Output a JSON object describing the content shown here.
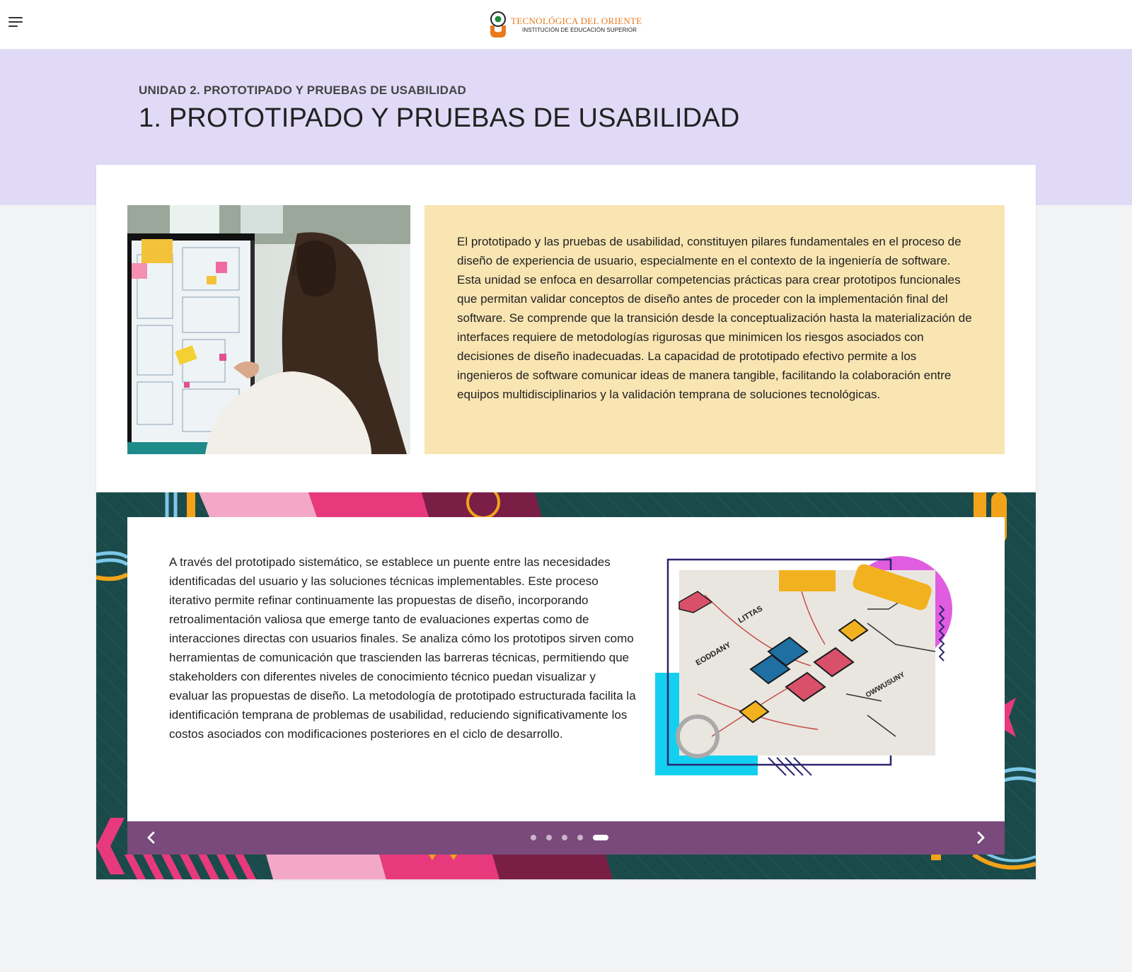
{
  "header": {
    "menu_icon": "hamburger-menu-icon",
    "logo": {
      "name": "TECNOLÓGICA DEL ORIENTE",
      "subtitle": "INSTITUCIÓN DE EDUCACIÓN SUPERIOR",
      "colors": {
        "orange": "#e9791e",
        "green": "#1e8a3c"
      }
    }
  },
  "hero": {
    "unit_label": "UNIDAD 2. PROTOTIPADO Y PRUEBAS DE USABILIDAD",
    "title": "1. PROTOTIPADO Y PRUEBAS DE USABILIDAD",
    "band_color": "#e0daf7"
  },
  "intro": {
    "image": "woman-at-monitor-with-sticky-notes",
    "text": "El prototipado y las pruebas de usabilidad, constituyen pilares fundamentales en el proceso de diseño de experiencia de usuario, especialmente en el contexto de la ingeniería de software. Esta unidad se enfoca en desarrollar competencias prácticas para crear prototipos funcionales que permitan validar conceptos de diseño antes de proceder con la implementación final del software. Se comprende que la transición desde la conceptualización hasta la materialización de interfaces requiere de metodologías rigurosas que minimicen los riesgos asociados con decisiones de diseño inadecuadas. La capacidad de prototipado efectivo permite a los ingenieros de software comunicar ideas de manera tangible, facilitando la colaboración entre equipos multidisciplinarios y la validación temprana de soluciones tecnológicas.",
    "box_color": "#f9e5b2"
  },
  "slider": {
    "text": "A través del prototipado sistemático, se establece un puente entre las necesidades identificadas del usuario y las soluciones técnicas implementables. Este proceso iterativo permite refinar continuamente las propuestas de diseño, incorporando retroalimentación valiosa que emerge tanto de evaluaciones expertas como de interacciones directas con usuarios finales. Se analiza cómo los prototipos sirven como herramientas de comunicación que trascienden las barreras técnicas, permitiendo que stakeholders con diferentes niveles de conocimiento técnico puedan visualizar y evaluar las propuestas de diseño. La metodología de prototipado estructurada facilita la identificación temprana de problemas de usabilidad, reduciendo significativamente los costos asociados con modificaciones posteriores en el ciclo de desarrollo.",
    "image": "prototype-flow-diagram-on-paper",
    "image_labels": [
      "EODDANY",
      "LITTAS",
      "OWWUSUNY"
    ],
    "slide_count": 5,
    "active_slide": 5,
    "prev_icon": "chevron-left-icon",
    "next_icon": "chevron-right-icon",
    "bar_color": "#7a4a7c",
    "deco_colors": {
      "teal": "#1b4a4a",
      "pink": "#e8397d",
      "light_pink": "#f4a8c8",
      "maroon": "#7a1e46",
      "orange": "#f2a319",
      "cyan": "#13d0f0",
      "magenta": "#e05ce0"
    }
  }
}
